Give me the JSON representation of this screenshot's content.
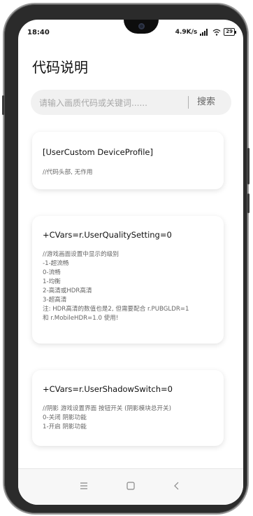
{
  "status_bar": {
    "time": "18:40",
    "network_speed": "4.9K/s",
    "battery": "29"
  },
  "page_title": "代码说明",
  "search": {
    "placeholder": "请输入画质代码或关键词......",
    "button_label": "搜索"
  },
  "cards": [
    {
      "title": "[UserCustom DeviceProfile]",
      "lines": [
        "//代码头部, 无作用"
      ]
    },
    {
      "title": "+CVars=r.UserQualitySetting=0",
      "lines": [
        "//游戏画面设置中显示的级别",
        "-1-超流畅",
        "0-流畅",
        "1-均衡",
        "2-高清或HDR高清",
        "3-超高清",
        "注: HDR高清的数值也是2, 但需要配合 r.PUBGLDR=1",
        "和 r.MobileHDR=1.0 使用!"
      ]
    },
    {
      "title": "+CVars=r.UserShadowSwitch=0",
      "lines": [
        "//阴影 游戏设置界面 按钮开关 (阴影模块总开关)",
        "0-关闭 阴影功能",
        "1-开启 阴影功能"
      ]
    }
  ],
  "nav_bar": {
    "icons": [
      "menu-icon",
      "home-icon",
      "back-icon"
    ]
  },
  "colors": {
    "background": "#ffffff",
    "search_bg": "#f1f1f1",
    "title_text": "#111111",
    "body_text": "#666666"
  }
}
